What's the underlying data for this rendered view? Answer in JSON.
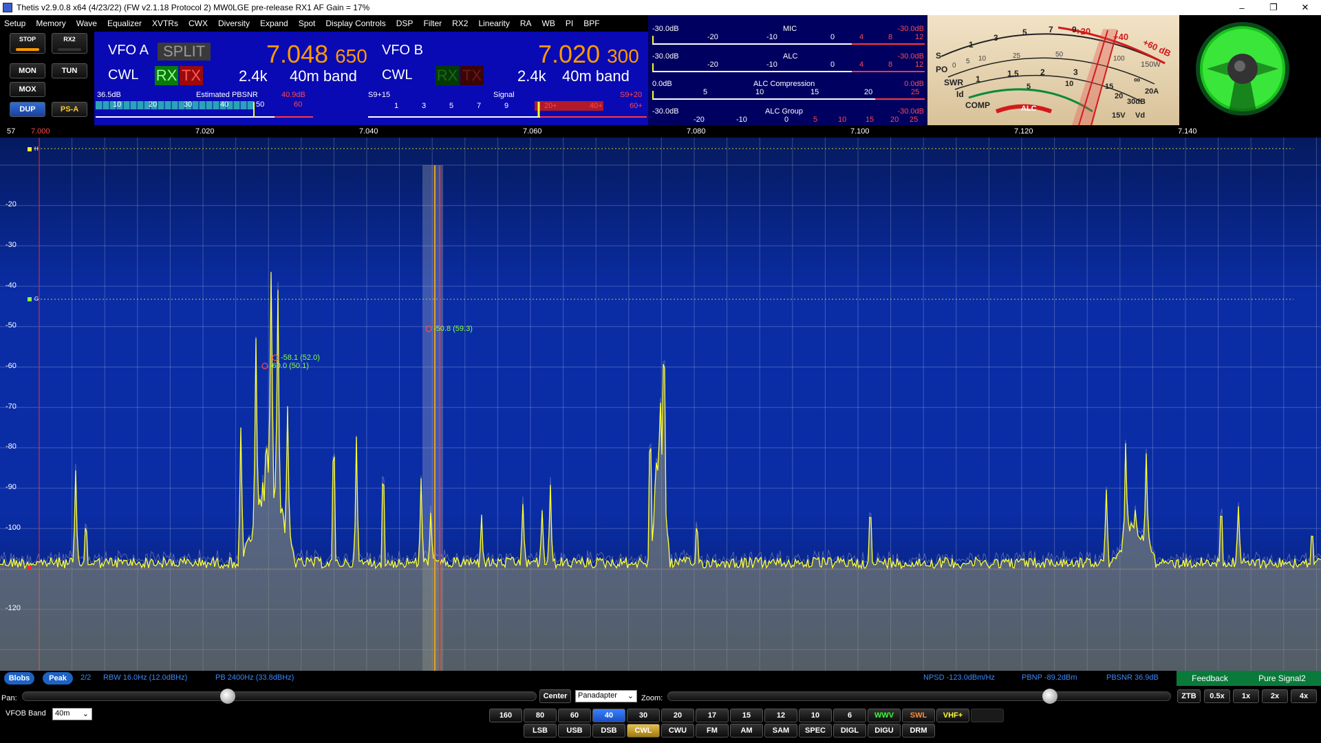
{
  "window": {
    "title": "Thetis v2.9.0.8 x64 (4/23/22) (FW v2.1.18 Protocol 2) MW0LGE pre-release   RX1 AF Gain = 17%",
    "minimize": "–",
    "maximize": "❐",
    "close": "✕"
  },
  "menu": [
    "Setup",
    "Memory",
    "Wave",
    "Equalizer",
    "XVTRs",
    "CWX",
    "Diversity",
    "Expand",
    "Spot",
    "Display Controls",
    "DSP",
    "Filter",
    "RX2",
    "Linearity",
    "RA",
    "WB",
    "PI",
    "BPF"
  ],
  "left_buttons": {
    "stop": "STOP",
    "rx2": "RX2",
    "mon": "MON",
    "tun": "TUN",
    "mox": "MOX",
    "dup": "DUP",
    "psa": "PS-A"
  },
  "vfo_a": {
    "label": "VFO A",
    "split": "SPLIT",
    "mode": "CWL",
    "rx": "RX",
    "tx": "TX",
    "freq_main": "7.048",
    "freq_sub": "650",
    "bandwidth": "2.4k",
    "band": "40m band",
    "meter_left": "36.5dB",
    "meter_title": "Estimated PBSNR",
    "meter_right": "40.9dB",
    "ticks": [
      "10",
      "20",
      "30",
      "40",
      "50",
      "60"
    ]
  },
  "vfo_b": {
    "label": "VFO B",
    "mode": "CWL",
    "rx": "RX",
    "tx": "TX",
    "freq_main": "7.020",
    "freq_sub": "300",
    "bandwidth": "2.4k",
    "band": "40m band",
    "meter_left": "S9+15",
    "meter_title": "Signal",
    "meter_right": "S9+20",
    "ticks": [
      "1",
      "3",
      "5",
      "7",
      "9",
      "20+",
      "40+",
      "60+"
    ]
  },
  "meters": [
    {
      "left": "-30.0dB",
      "title": "MIC",
      "right": "-30.0dB",
      "ticks": [
        "-20",
        "-10",
        "0"
      ],
      "red_ticks": [
        "4",
        "8",
        "12"
      ]
    },
    {
      "left": "-30.0dB",
      "title": "ALC",
      "right": "-30.0dB",
      "ticks": [
        "-20",
        "-10",
        "0"
      ],
      "red_ticks": [
        "4",
        "8",
        "12"
      ]
    },
    {
      "left": "0.0dB",
      "title": "ALC Compression",
      "right": "0.0dB",
      "ticks": [
        "5",
        "10",
        "15",
        "20"
      ],
      "red_ticks": [
        "25"
      ]
    },
    {
      "left": "-30.0dB",
      "title": "ALC Group",
      "right": "-30.0dB",
      "ticks": [
        "-20",
        "-10",
        "0"
      ],
      "red_ticks": [
        "5",
        "10",
        "15",
        "20",
        "25"
      ]
    }
  ],
  "analog_meter": {
    "labels": [
      "S",
      "PO",
      "SWR",
      "Id",
      "COMP",
      "ALC",
      "15V",
      "Vd",
      "20A",
      "30dB",
      "150W",
      "+20",
      "+40",
      "+60 dB"
    ],
    "s_ticks": [
      "1",
      "3",
      "5",
      "7",
      "9"
    ],
    "po_ticks": [
      "0",
      "5",
      "10",
      "25",
      "50",
      "100"
    ],
    "swr_ticks": [
      "1",
      "1.5",
      "2",
      "3",
      "∞"
    ],
    "id_ticks": [
      "5",
      "10",
      "15",
      "20"
    ]
  },
  "freq_scale": {
    "corner": "57",
    "labels": [
      "7.000",
      "7.020",
      "7.040",
      "7.060",
      "7.080",
      "7.100",
      "7.120",
      "7.140"
    ]
  },
  "panadapter": {
    "db_labels": [
      "-20",
      "-30",
      "-40",
      "-50",
      "-60",
      "-70",
      "-80",
      "-90",
      "-100",
      "-120"
    ],
    "marker_h": "H",
    "marker_g": "G",
    "peaks": [
      {
        "label": "-58.1 (52.0)"
      },
      {
        "label": "-60.0 (50.1)"
      },
      {
        "label": "-50.8 (59.3)"
      }
    ],
    "colors": {
      "trace": "#ffff33",
      "vfo_a_line": "#ff2a2a",
      "vfo_b_line": "#e8a020"
    }
  },
  "status": {
    "blobs": "Blobs",
    "peak": "Peak",
    "page": "2/2",
    "rbw": "RBW 16.0Hz (12.0dBHz)",
    "pb": "PB 2400Hz (33.8dBHz)",
    "npsd": "NPSD -123.0dBm/Hz",
    "pbnp": "PBNP -89.2dBm",
    "pbsnr": "PBSNR 36.9dB",
    "feedback": "Feedback",
    "pure_signal": "Pure Signal2"
  },
  "bottom": {
    "pan_label": "Pan:",
    "center": "Center",
    "display_mode": "Panadapter",
    "zoom_label": "Zoom:",
    "ztb": "ZTB",
    "zoom_buttons": [
      "0.5x",
      "1x",
      "2x",
      "4x"
    ],
    "vfob_band_label": "VFOB Band",
    "vfob_band_value": "40m",
    "bands": [
      "160",
      "80",
      "60",
      "40",
      "30",
      "20",
      "17",
      "15",
      "12",
      "10",
      "6",
      "WWV",
      "SWL",
      "VHF+"
    ],
    "modes": [
      "LSB",
      "USB",
      "DSB",
      "CWL",
      "CWU",
      "FM",
      "AM",
      "SAM",
      "SPEC",
      "DIGL",
      "DIGU",
      "DRM"
    ],
    "pan_value": 0.4,
    "zoom_value": 0.76
  }
}
